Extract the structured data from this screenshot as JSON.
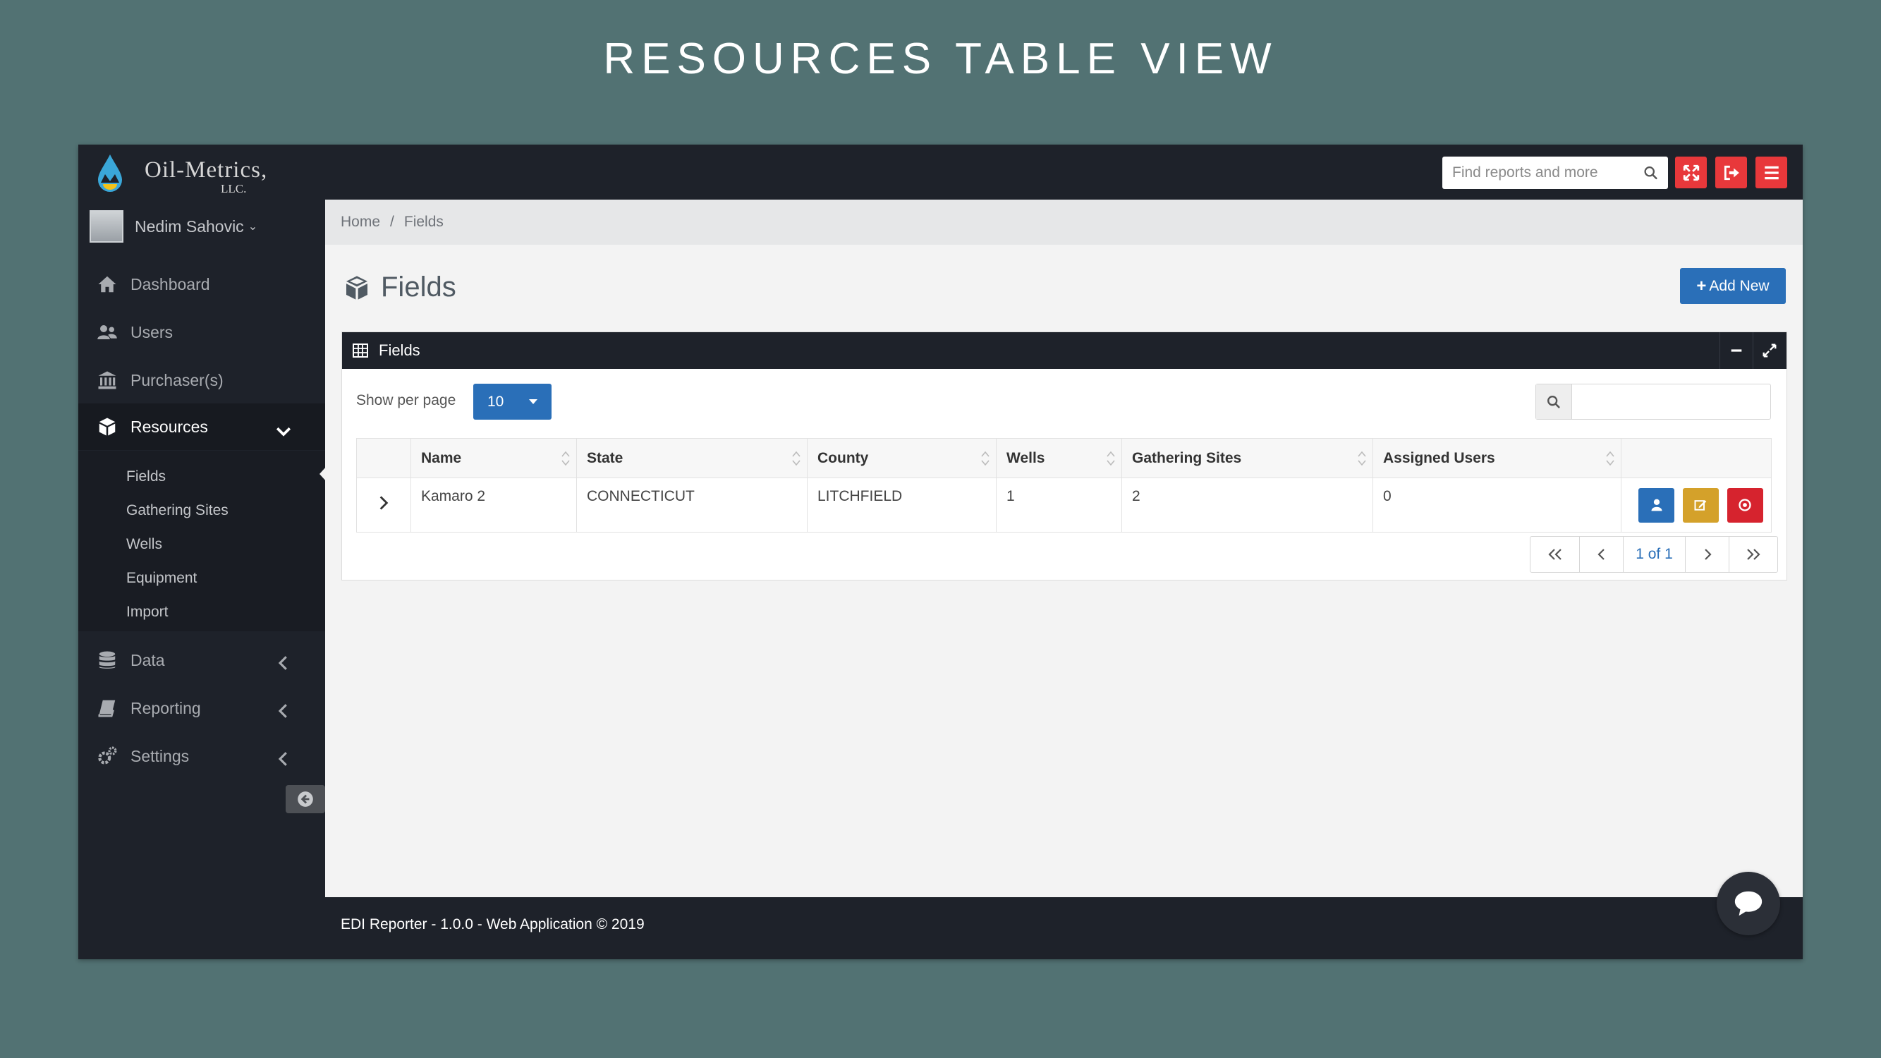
{
  "slide_title": "RESOURCES TABLE VIEW",
  "header": {
    "logo_text": "Oil-Metrics,",
    "logo_sub": "LLC.",
    "search_placeholder": "Find reports and more"
  },
  "user": {
    "name": "Nedim Sahovic"
  },
  "sidebar": {
    "items": [
      {
        "label": "Dashboard",
        "icon": "home-icon"
      },
      {
        "label": "Users",
        "icon": "users-icon"
      },
      {
        "label": "Purchaser(s)",
        "icon": "bank-icon"
      },
      {
        "label": "Resources",
        "icon": "cube-icon",
        "active": true
      },
      {
        "label": "Data",
        "icon": "database-icon"
      },
      {
        "label": "Reporting",
        "icon": "book-icon"
      },
      {
        "label": "Settings",
        "icon": "cogs-icon"
      }
    ],
    "submenu": [
      "Fields",
      "Gathering Sites",
      "Wells",
      "Equipment",
      "Import"
    ]
  },
  "breadcrumb": {
    "home": "Home",
    "separator": "/",
    "current": "Fields"
  },
  "page": {
    "title": "Fields",
    "add_button": "Add New"
  },
  "panel": {
    "title": "Fields",
    "per_page_label": "Show per page",
    "per_page_value": "10",
    "columns": [
      "Name",
      "State",
      "County",
      "Wells",
      "Gathering Sites",
      "Assigned Users"
    ],
    "rows": [
      {
        "name": "Kamaro 2",
        "state": "CONNECTICUT",
        "county": "LITCHFIELD",
        "wells": "1",
        "gathering_sites": "2",
        "assigned_users": "0"
      }
    ],
    "pagination": {
      "page_info": "1 of 1"
    }
  },
  "footer": {
    "text": "EDI Reporter - 1.0.0 - Web Application © 2019"
  },
  "colors": {
    "header_bg": "#1e222a",
    "primary": "#2a6fb8",
    "danger": "#e8383b",
    "warning": "#d4a12a",
    "delete": "#d6232e",
    "background": "#527273"
  }
}
